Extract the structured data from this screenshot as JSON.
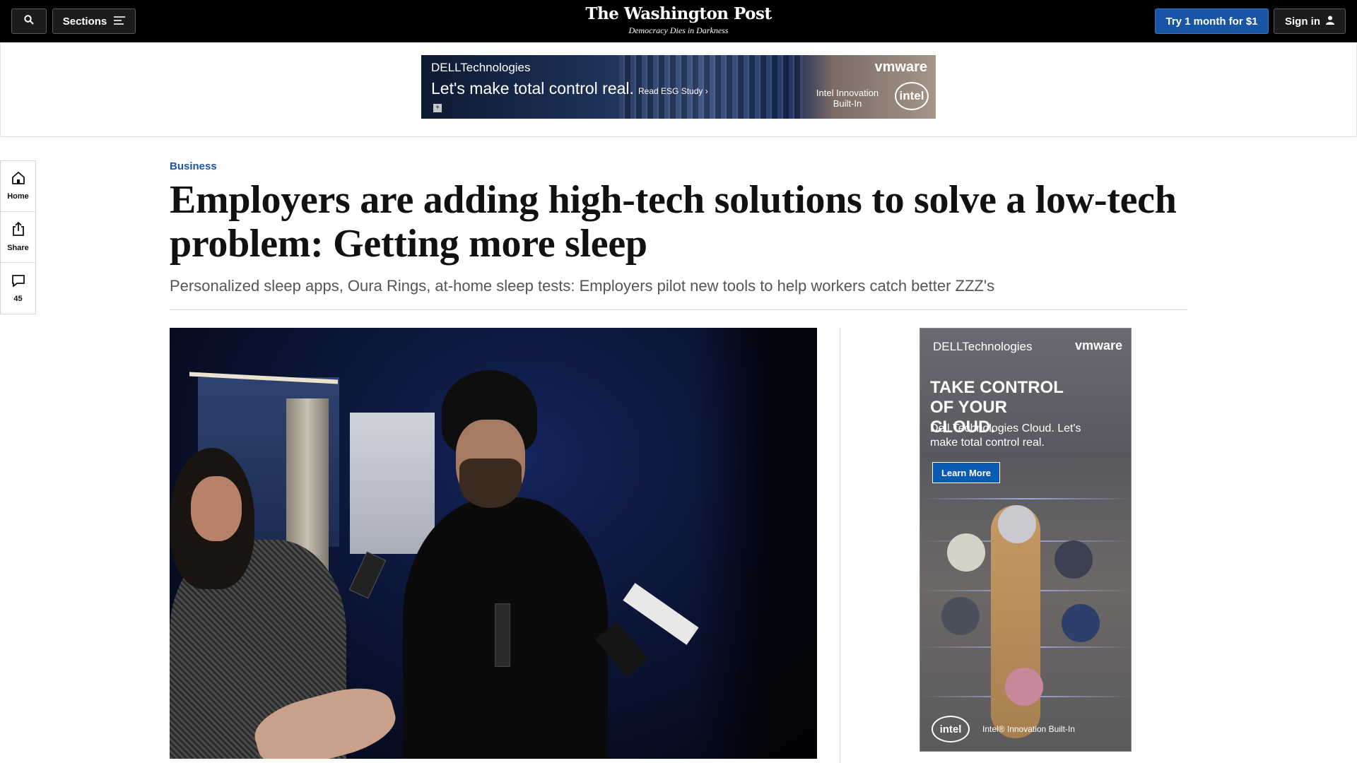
{
  "nav": {
    "search_icon": "search-icon",
    "sections_label": "Sections",
    "menu_icon": "hamburger-icon",
    "logo": "The Washington Post",
    "tagline": "Democracy Dies in Darkness",
    "subscribe_label": "Try 1 month for $1",
    "signin_label": "Sign in",
    "user_icon": "user-icon"
  },
  "top_ad": {
    "brand": "DELLTechnologies",
    "headline": "Let's make total control real.",
    "cta": "Read ESG Study ›",
    "partner": "vmware",
    "intel_text": "Intel Innovation Built-In",
    "intel_logo": "intel"
  },
  "rail": {
    "items": [
      {
        "icon": "home-icon",
        "label": "Home"
      },
      {
        "icon": "share-icon",
        "label": "Share"
      },
      {
        "icon": "comment-icon",
        "label": "45"
      }
    ]
  },
  "article": {
    "kicker": "Business",
    "headline": "Employers are adding high-tech solutions to solve a low-tech problem: Getting more sleep",
    "subhead": "Personalized sleep apps, Oura Rings, at-home sleep tests: Employers pilot new tools to help workers catch better ZZZ's"
  },
  "side_ad": {
    "brand": "DELLTechnologies",
    "partner": "vmware",
    "headline": "TAKE CONTROL OF YOUR CLOUD.",
    "body": "Dell Technologies Cloud. Let's make total control real.",
    "cta": "Learn More",
    "intel_logo": "intel",
    "intel_text": "Intel® Innovation Built-In"
  },
  "colors": {
    "nav_bg": "#000000",
    "accent_blue": "#1955a5",
    "kicker": "#1955a5"
  }
}
